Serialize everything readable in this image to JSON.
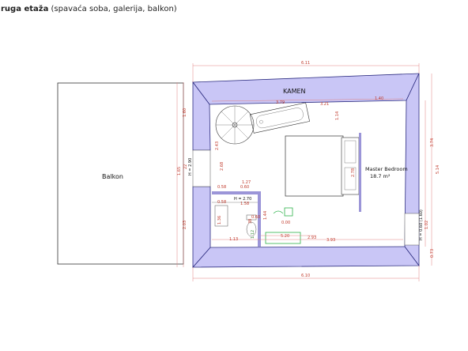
{
  "heading": {
    "bold": "ruga etaža",
    "rest": " (spavaća soba, galerija, balkon)"
  },
  "labels": {
    "balkon": "Balkon",
    "kamen": "KAMEN",
    "master_name": "Master Bedroom",
    "master_area": "18.7 m²",
    "h_left": "H = 2.90",
    "h_mid": "H = 2.70",
    "h_right": "H = 0.60 (1.60)"
  },
  "dims": {
    "top_total": "6.11",
    "bottom_total": "6.10",
    "left_top": "1.60",
    "left_mid_a": "1.65",
    "left_mid_b": "22",
    "left_bottom": "2.03",
    "right_a": "3.74",
    "right_b": "5.14",
    "right_c": "1.02",
    "right_d": "0.73",
    "inner_379": "3.79",
    "inner_321": "3.21",
    "inner_140": "1.40",
    "inner_114": "1.14",
    "inner_243": "2.43",
    "inner_268": "2.68",
    "inner_278": "2.78",
    "inner_127": "1.27",
    "inner_058a": "0.58",
    "inner_058b": "0.58",
    "inner_060a": "0.60",
    "inner_060b": "0.60",
    "inner_158": "1.58",
    "inner_136": "1.36",
    "inner_113": "1.13",
    "inner_520": "5.20",
    "inner_393": "3.93",
    "inner_293": "2.93",
    "inner_144": "1.44",
    "inner_000": "0.00",
    "inner_038": "38",
    "inner_012": "1.12"
  },
  "colors": {
    "wall_fill": "#c9c6f6",
    "dimension": "#c0392b",
    "accent_green": "#2db24a"
  }
}
